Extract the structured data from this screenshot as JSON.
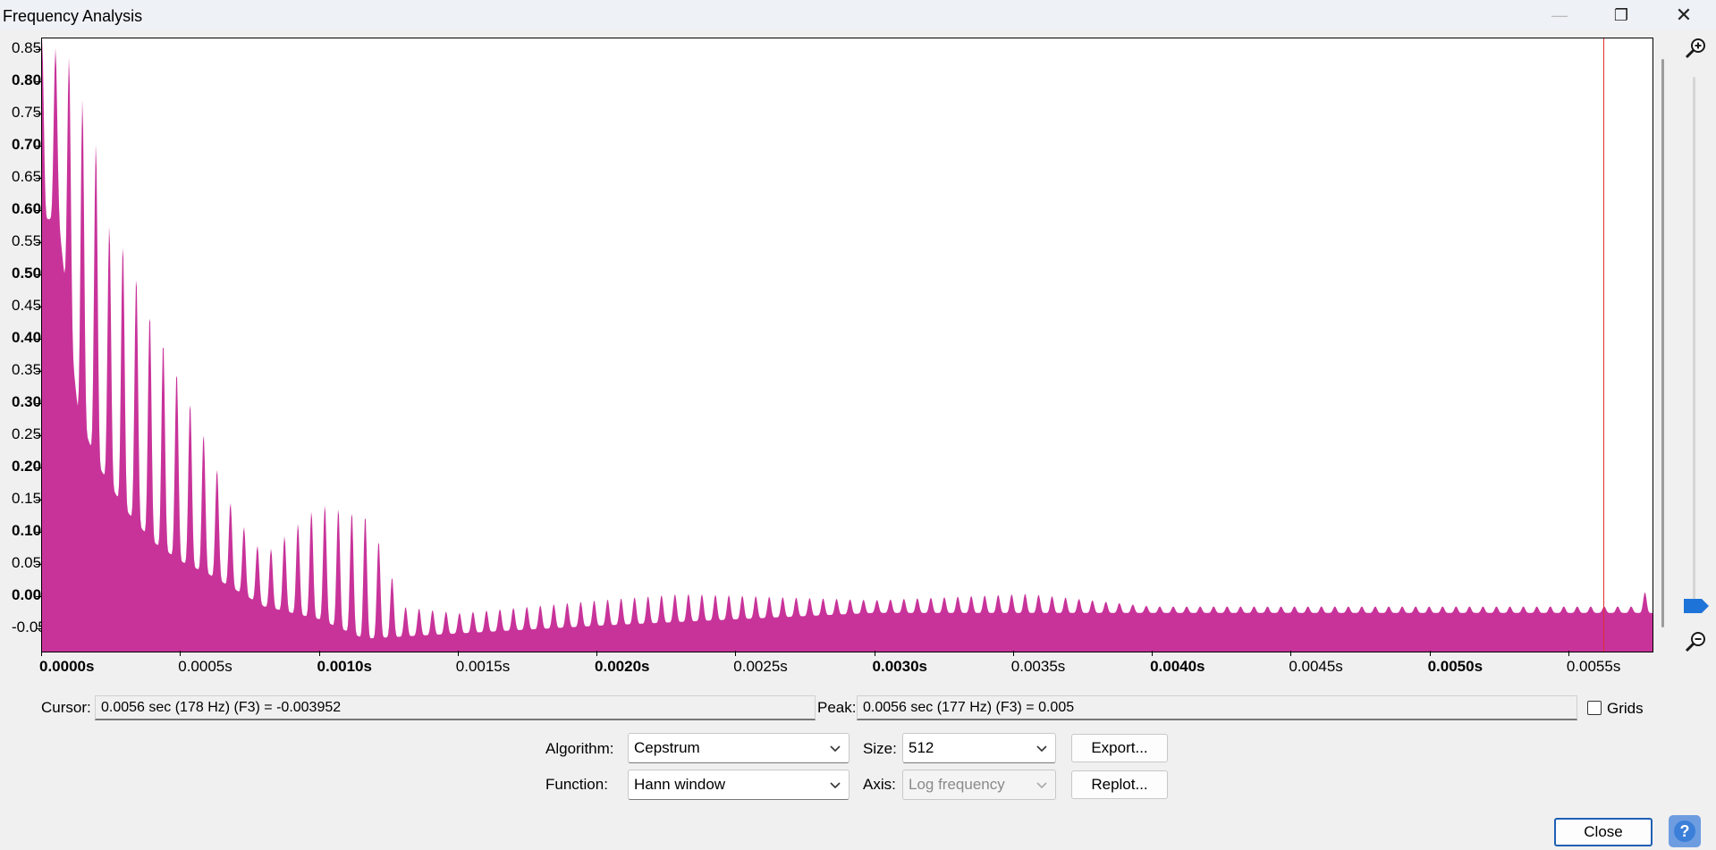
{
  "window": {
    "title": "Frequency Analysis",
    "minimize_icon": "—",
    "restore_icon": "❐",
    "close_icon": "✕"
  },
  "plot": {
    "fill_color": "#c8339a",
    "cursor_color": "#e03030",
    "cursor_x_value": 0.0056,
    "y_tick_labels": [
      "0.85",
      "0.80",
      "0.75",
      "0.70",
      "0.65",
      "0.60",
      "0.55",
      "0.50",
      "0.45",
      "0.40",
      "0.35",
      "0.30",
      "0.25",
      "0.20",
      "0.15",
      "0.10",
      "0.05",
      "0.00",
      "-0.05"
    ],
    "y_tick_bold": [
      false,
      true,
      false,
      true,
      false,
      true,
      false,
      true,
      false,
      true,
      false,
      true,
      false,
      true,
      false,
      true,
      false,
      true,
      false
    ],
    "x_tick_labels": [
      "0.0000s",
      "0.0005s",
      "0.0010s",
      "0.0015s",
      "0.0020s",
      "0.0025s",
      "0.0030s",
      "0.0035s",
      "0.0040s",
      "0.0045s",
      "0.0050s",
      "0.0055s"
    ],
    "x_tick_bold": [
      true,
      false,
      true,
      false,
      true,
      false,
      true,
      false,
      true,
      false,
      true,
      false
    ]
  },
  "chart_data": {
    "type": "area",
    "x_unit": "s",
    "xlim": [
      0,
      0.0058
    ],
    "ylim": [
      -0.07,
      0.88
    ],
    "peaks": [
      {
        "x": 0.0,
        "y": 0.88
      },
      {
        "x": 0.0001,
        "y": 0.85
      },
      {
        "x": 0.00015,
        "y": 0.78
      },
      {
        "x": 0.0002,
        "y": 0.71
      },
      {
        "x": 0.00025,
        "y": 0.57
      },
      {
        "x": 0.0003,
        "y": 0.56
      },
      {
        "x": 0.00035,
        "y": 0.5
      },
      {
        "x": 0.0004,
        "y": 0.44
      },
      {
        "x": 0.00045,
        "y": 0.4
      },
      {
        "x": 0.0005,
        "y": 0.35
      },
      {
        "x": 0.00055,
        "y": 0.3
      },
      {
        "x": 0.0006,
        "y": 0.25
      },
      {
        "x": 0.00065,
        "y": 0.19
      },
      {
        "x": 0.0007,
        "y": 0.14
      },
      {
        "x": 0.0008,
        "y": 0.08
      },
      {
        "x": 0.001,
        "y": 0.16
      },
      {
        "x": 0.00118,
        "y": 0.14
      },
      {
        "x": 0.0013,
        "y": 0.0
      },
      {
        "x": 0.0015,
        "y": -0.01
      },
      {
        "x": 0.002,
        "y": 0.01
      },
      {
        "x": 0.0023,
        "y": 0.02
      },
      {
        "x": 0.003,
        "y": 0.01
      },
      {
        "x": 0.00355,
        "y": 0.02
      },
      {
        "x": 0.004,
        "y": 0.0
      },
      {
        "x": 0.0045,
        "y": 0.0
      },
      {
        "x": 0.005,
        "y": 0.0
      },
      {
        "x": 0.00575,
        "y": 0.0
      },
      {
        "x": 0.0058,
        "y": 0.05
      }
    ],
    "troughs": [
      {
        "x": 6e-05,
        "y": 0.6
      },
      {
        "x": 0.00013,
        "y": 0.3
      },
      {
        "x": 0.0002,
        "y": 0.22
      },
      {
        "x": 0.0003,
        "y": 0.15
      },
      {
        "x": 0.0004,
        "y": 0.1
      },
      {
        "x": 0.0005,
        "y": 0.07
      },
      {
        "x": 0.0006,
        "y": 0.05
      },
      {
        "x": 0.0008,
        "y": 0.0
      },
      {
        "x": 0.001,
        "y": -0.02
      },
      {
        "x": 0.00116,
        "y": -0.05
      },
      {
        "x": 0.002,
        "y": -0.03
      },
      {
        "x": 0.003,
        "y": -0.01
      },
      {
        "x": 0.0058,
        "y": -0.01
      }
    ]
  },
  "readouts": {
    "cursor_label": "Cursor:",
    "cursor_value": "0.0056 sec (178 Hz) (F3) = -0.003952",
    "peak_label": "Peak:",
    "peak_value": "0.0056 sec (177 Hz) (F3) = 0.005",
    "grids_label": "Grids",
    "grids_checked": false
  },
  "controls": {
    "algorithm_label": "Algorithm:",
    "algorithm_value": "Cepstrum",
    "function_label": "Function:",
    "function_value": "Hann window",
    "size_label": "Size:",
    "size_value": "512",
    "axis_label": "Axis:",
    "axis_value": "Log frequency",
    "export_label": "Export...",
    "replot_label": "Replot...",
    "close_label": "Close",
    "help_icon": "?"
  }
}
